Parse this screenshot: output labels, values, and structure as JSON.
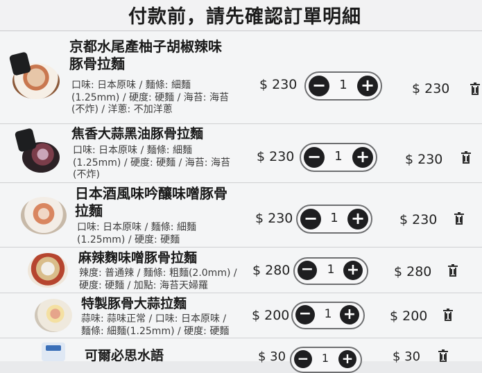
{
  "header": {
    "title": "付款前，請先確認訂單明細"
  },
  "items": [
    {
      "name_line1": "京都水尾產柚子胡椒辣味",
      "name_line2": "豚骨拉麵",
      "desc_lines": [
        "口味: 日本原味 / 麵條: 細麵",
        "(1.25mm) / 硬度: 硬麵 / 海苔: 海苔",
        "(不炸) / 洋蔥: 不加洋蔥"
      ],
      "unit_price": "$ 230",
      "quantity": "1",
      "subtotal": "$ 230"
    },
    {
      "name_line1": "焦香大蒜黑油豚骨拉麵",
      "desc_lines": [
        "口味: 日本原味 / 麵條: 細麵",
        "(1.25mm) / 硬度: 硬麵 / 海苔: 海苔",
        "(不炸)"
      ],
      "unit_price": "$ 230",
      "quantity": "1",
      "subtotal": "$ 230"
    },
    {
      "name_line1": "日本酒風味吟釀味噌豚骨",
      "name_line2": "拉麵",
      "desc_lines": [
        "口味: 日本原味 / 麵條: 細麵",
        "(1.25mm) / 硬度: 硬麵"
      ],
      "unit_price": "$ 230",
      "quantity": "1",
      "subtotal": "$ 230"
    },
    {
      "name_line1": "麻辣麴味噌豚骨拉麵",
      "desc_lines": [
        "辣度: 普通辣 / 麵條: 粗麵(2.0mm) /",
        "硬度: 硬麵 / 加點: 海苔天婦羅"
      ],
      "unit_price": "$ 280",
      "quantity": "1",
      "subtotal": "$ 280"
    },
    {
      "name_line1": "特製豚骨大蒜拉麵",
      "desc_lines": [
        "蒜味: 蒜味正常 / 口味: 日本原味 /",
        "麵條: 細麵(1.25mm) / 硬度: 硬麵"
      ],
      "unit_price": "$ 200",
      "quantity": "1",
      "subtotal": "$ 200"
    },
    {
      "name_line1": "可爾必思水語",
      "unit_price": "$ 30",
      "quantity": "1",
      "subtotal": "$ 30"
    }
  ],
  "icons": {
    "minus": "minus-icon",
    "plus": "plus-icon",
    "delete": "trash-icon"
  }
}
